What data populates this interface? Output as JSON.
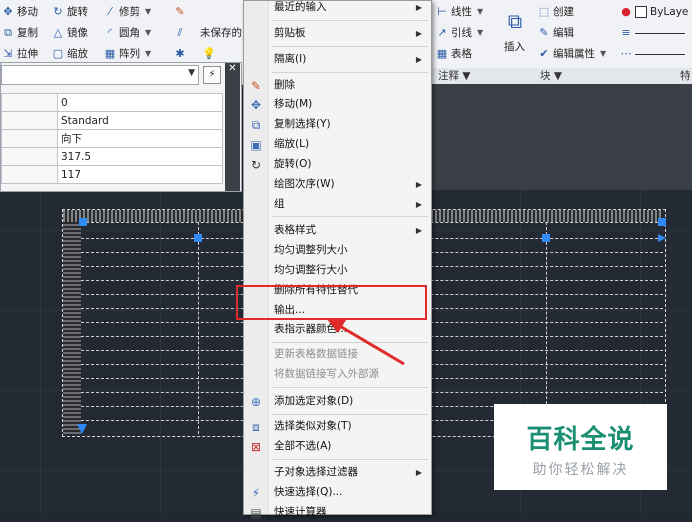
{
  "ribbon": {
    "modify_row1": [
      "移动",
      "旋转",
      "修剪"
    ],
    "modify_row2": [
      "复制",
      "镜像",
      "圆角"
    ],
    "modify_row3": [
      "拉伸",
      "缩放",
      "阵列"
    ],
    "layer_unsaved": "未保存的",
    "annotation": [
      "线性",
      "引线",
      "表格"
    ],
    "annotation_panel": "注释",
    "insert_label": "插入",
    "block_items": [
      "创建",
      "编辑",
      "编辑属性"
    ],
    "block_panel": "块",
    "bylayer": "ByLaye",
    "special": "特"
  },
  "properties": {
    "rows": [
      {
        "key": "",
        "value": "0"
      },
      {
        "key": "",
        "value": "Standard"
      },
      {
        "key": "",
        "value": "向下"
      },
      {
        "key": "",
        "value": "317.5"
      },
      {
        "key": "",
        "value": "117"
      }
    ]
  },
  "menu": {
    "items": [
      {
        "label": "最近的输入",
        "submenu": true
      },
      {
        "label": "剪贴板",
        "submenu": true
      },
      {
        "label": "隔离(I)",
        "submenu": true
      },
      {
        "label": "删除",
        "icon": "eraser-icon"
      },
      {
        "label": "移动(M)",
        "icon": "move-icon"
      },
      {
        "label": "复制选择(Y)",
        "icon": "copy-icon"
      },
      {
        "label": "缩放(L)",
        "icon": "scale-icon"
      },
      {
        "label": "旋转(O)",
        "icon": "rotate-icon"
      },
      {
        "label": "绘图次序(W)",
        "submenu": true
      },
      {
        "label": "组",
        "submenu": true
      },
      {
        "label": "表格样式",
        "submenu": true
      },
      {
        "label": "均匀调整列大小"
      },
      {
        "label": "均匀调整行大小"
      },
      {
        "label": "删除所有特性替代"
      },
      {
        "label": "输出..."
      },
      {
        "label": "表指示器颜色..."
      },
      {
        "label": "更新表格数据链接",
        "disabled": true
      },
      {
        "label": "将数据链接写入外部源",
        "disabled": true
      },
      {
        "label": "添加选定对象(D)",
        "icon": "add-select-icon"
      },
      {
        "label": "选择类似对象(T)",
        "icon": "select-similar-icon"
      },
      {
        "label": "全部不选(A)",
        "icon": "deselect-icon"
      },
      {
        "label": "子对象选择过滤器",
        "submenu": true
      },
      {
        "label": "快速选择(Q)...",
        "icon": "quick-select-icon"
      },
      {
        "label": "快速计算器",
        "icon": "calculator-icon"
      }
    ]
  },
  "watermark": {
    "title": "百科全说",
    "subtitle": "助你轻松解决"
  },
  "colors": {
    "highlight": "#e02b2b",
    "canvas": "#232a33",
    "grip": "#2f8af5"
  }
}
